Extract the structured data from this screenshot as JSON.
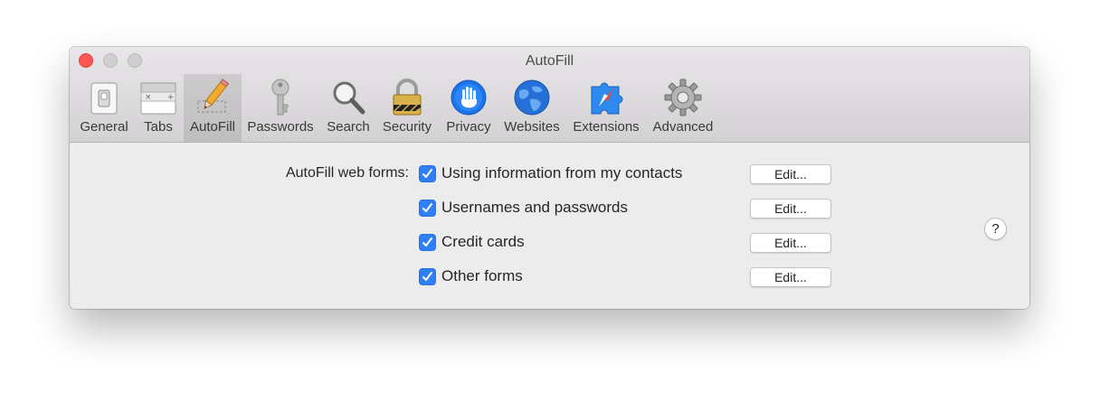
{
  "window": {
    "title": "AutoFill"
  },
  "toolbar": {
    "tabs": [
      {
        "label": "General",
        "icon": "general-switch-icon",
        "selected": false
      },
      {
        "label": "Tabs",
        "icon": "tabs-icon",
        "selected": false
      },
      {
        "label": "AutoFill",
        "icon": "pencil-icon",
        "selected": true
      },
      {
        "label": "Passwords",
        "icon": "key-icon",
        "selected": false
      },
      {
        "label": "Search",
        "icon": "magnifier-icon",
        "selected": false
      },
      {
        "label": "Security",
        "icon": "padlock-icon",
        "selected": false
      },
      {
        "label": "Privacy",
        "icon": "hand-icon",
        "selected": false
      },
      {
        "label": "Websites",
        "icon": "globe-icon",
        "selected": false
      },
      {
        "label": "Extensions",
        "icon": "puzzle-icon",
        "selected": false
      },
      {
        "label": "Advanced",
        "icon": "gear-icon",
        "selected": false
      }
    ]
  },
  "autofill": {
    "label": "AutoFill web forms:",
    "options": [
      {
        "label": "Using information from my contacts",
        "checked": true,
        "button": "Edit..."
      },
      {
        "label": "Usernames and passwords",
        "checked": true,
        "button": "Edit..."
      },
      {
        "label": "Credit cards",
        "checked": true,
        "button": "Edit..."
      },
      {
        "label": "Other forms",
        "checked": true,
        "button": "Edit..."
      }
    ]
  },
  "help": {
    "label": "?"
  },
  "colors": {
    "accent": "#2f7ff6",
    "close": "#fc5753"
  }
}
